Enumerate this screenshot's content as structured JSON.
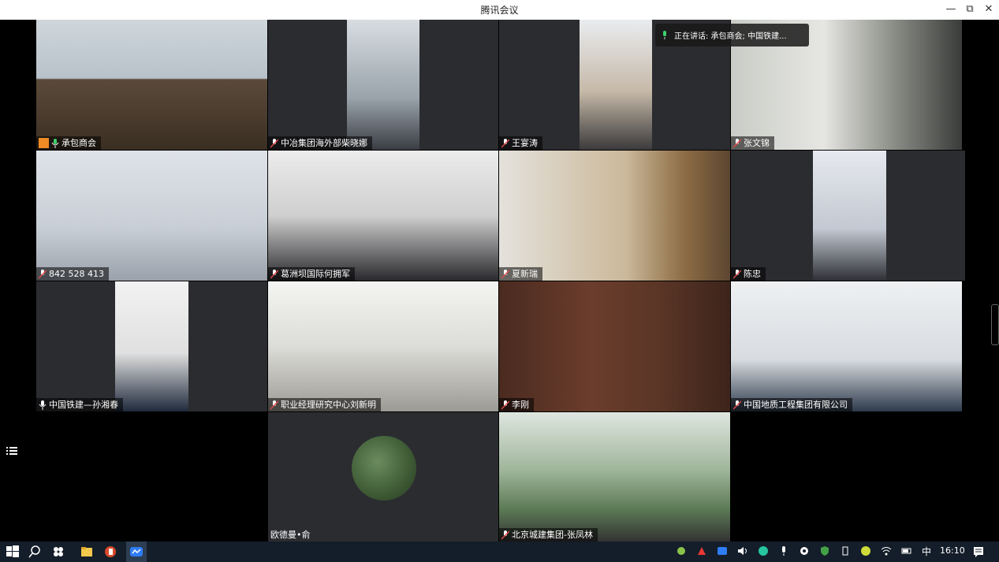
{
  "window": {
    "title": "腾讯会议",
    "minimize": "—",
    "restore": "⧉",
    "close": "✕"
  },
  "speaking_banner": "正在讲话: 承包商会; 中国铁建...",
  "participants": [
    {
      "name": "承包商会",
      "host": true,
      "active": true
    },
    {
      "name": "中冶集团海外部柴晓娜"
    },
    {
      "name": "王宴涛"
    },
    {
      "name": "张文锦"
    },
    {
      "name": "842 528 413"
    },
    {
      "name": "葛洲坝国际何拥军"
    },
    {
      "name": "夏新瑞"
    },
    {
      "name": "陈忠"
    },
    {
      "name": "中国铁建—孙湘春"
    },
    {
      "name": "职业经理研究中心刘新明"
    },
    {
      "name": "李刚"
    },
    {
      "name": "中国地质工程集团有限公司"
    },
    {
      "name": "欧德曼•俞"
    },
    {
      "name": "北京城建集团-张凤林"
    }
  ],
  "taskbar": {
    "time": "16:10",
    "ime": "中"
  }
}
